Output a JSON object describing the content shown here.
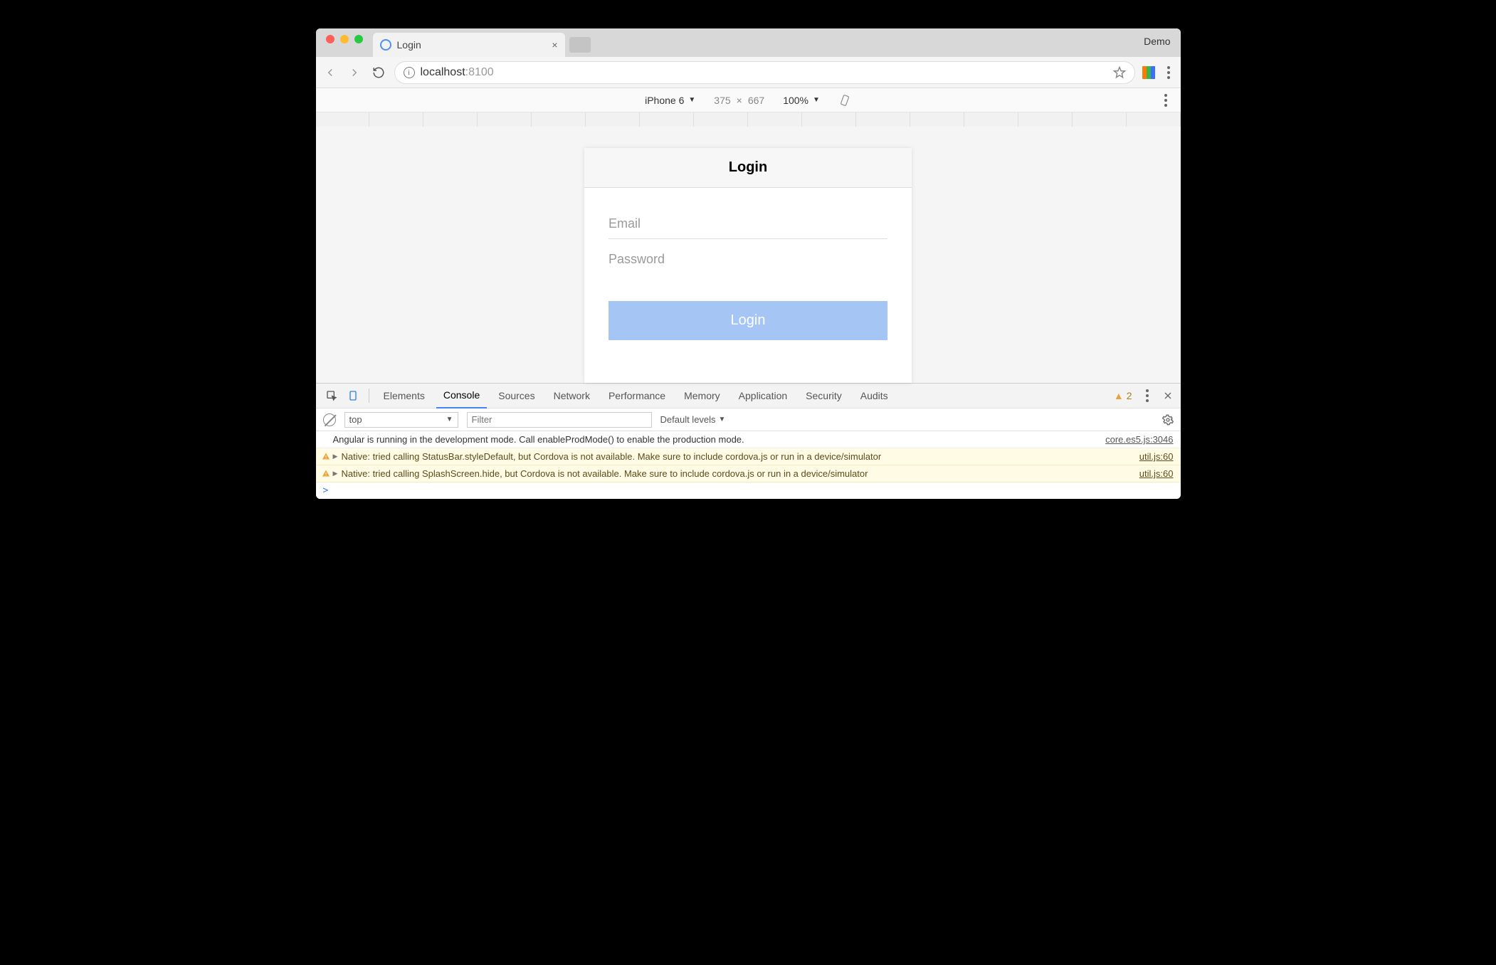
{
  "window": {
    "demo_label": "Demo"
  },
  "tab": {
    "title": "Login"
  },
  "address": {
    "host": "localhost",
    "port": ":8100"
  },
  "devicebar": {
    "device": "iPhone 6",
    "width": "375",
    "height": "667",
    "zoom": "100%"
  },
  "app": {
    "header": "Login",
    "email_placeholder": "Email",
    "password_placeholder": "Password",
    "login_button": "Login"
  },
  "devtools": {
    "tabs": [
      "Elements",
      "Console",
      "Sources",
      "Network",
      "Performance",
      "Memory",
      "Application",
      "Security",
      "Audits"
    ],
    "active_tab": "Console",
    "warn_count": "2"
  },
  "console_ctrl": {
    "context": "top",
    "filter_placeholder": "Filter",
    "levels": "Default levels"
  },
  "logs": [
    {
      "type": "log",
      "msg": "Angular is running in the development mode. Call enableProdMode() to enable the production mode.",
      "src": "core.es5.js:3046"
    },
    {
      "type": "warn",
      "msg": "Native: tried calling StatusBar.styleDefault, but Cordova is not available. Make sure to include cordova.js or run in a device/simulator",
      "src": "util.js:60"
    },
    {
      "type": "warn",
      "msg": "Native: tried calling SplashScreen.hide, but Cordova is not available. Make sure to include cordova.js or run in a device/simulator",
      "src": "util.js:60"
    }
  ],
  "prompt": ">"
}
